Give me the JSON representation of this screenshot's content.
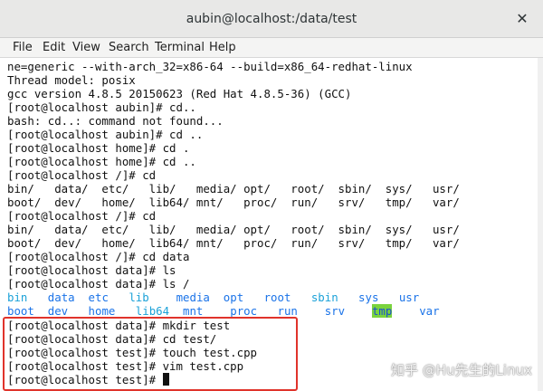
{
  "window": {
    "title": "aubin@localhost:/data/test",
    "close_glyph": "✕"
  },
  "menu": [
    "File",
    "Edit",
    "View",
    "Search",
    "Terminal",
    "Help"
  ],
  "terminal": {
    "lines": [
      "ne=generic --with-arch_32=x86-64 --build=x86_64-redhat-linux",
      "Thread model: posix",
      "gcc version 4.8.5 20150623 (Red Hat 4.8.5-36) (GCC)",
      "[root@localhost aubin]# cd..",
      "bash: cd..: command not found...",
      "[root@localhost aubin]# cd ..",
      "[root@localhost home]# cd .",
      "[root@localhost home]# cd ..",
      "[root@localhost /]# cd",
      "bin/   data/  etc/   lib/   media/ opt/   root/  sbin/  sys/   usr/",
      "boot/  dev/   home/  lib64/ mnt/   proc/  run/   srv/   tmp/   var/",
      "[root@localhost /]# cd",
      "bin/   data/  etc/   lib/   media/ opt/   root/  sbin/  sys/   usr/",
      "boot/  dev/   home/  lib64/ mnt/   proc/  run/   srv/   tmp/   var/",
      "[root@localhost /]# cd data",
      "[root@localhost data]# ls",
      "[root@localhost data]# ls /"
    ],
    "ls_row1": [
      "bin",
      "data",
      "etc",
      "lib",
      "media",
      "opt",
      "root",
      "sbin",
      "sys",
      "usr"
    ],
    "ls_row2": [
      "boot",
      "dev",
      "home",
      "lib64",
      "mnt",
      "proc",
      "run",
      "srv",
      "tmp",
      "var"
    ],
    "highlighted_lines": [
      "[root@localhost data]# mkdir test",
      "[root@localhost data]# cd test/",
      "[root@localhost test]# touch test.cpp",
      "[root@localhost test]# vim test.cpp",
      "[root@localhost test]# "
    ]
  },
  "colors": {
    "dir": "#1a73e8",
    "symlink": "#1aa1d8",
    "highlight_bg": "#7ad33d",
    "box": "#e0332b"
  },
  "watermark": "知乎 @Hu先生的Linux"
}
